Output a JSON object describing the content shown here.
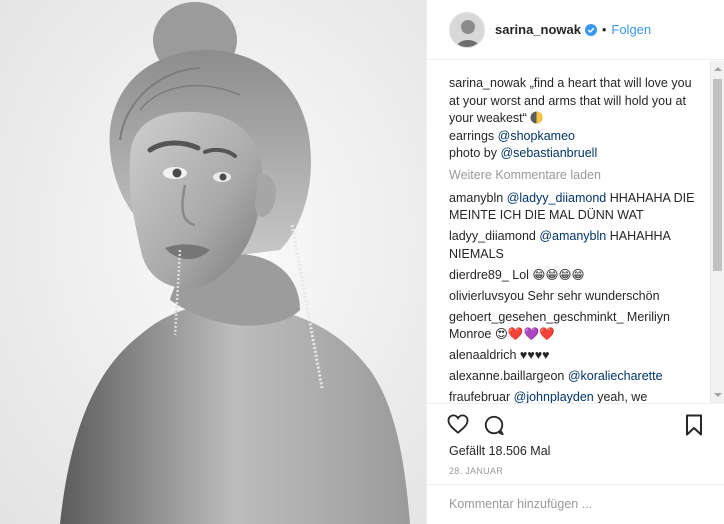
{
  "post": {
    "username": "sarina_nowak",
    "follow_label": "Folgen",
    "separator": "•",
    "photo_alt": "Black and white portrait photo",
    "caption": {
      "user": "sarina_nowak",
      "text": "„find a heart that will love you at your worst and arms that will hold you at your weakest“",
      "earrings_prefix": "earrings",
      "earrings_tag": "@shopkameo",
      "photo_prefix": "photo by",
      "photo_tag": "@sebastianbruell"
    },
    "load_more": "Weitere Kommentare laden",
    "comments": [
      {
        "user": "amanybln",
        "mention": "@ladyy_diiamond",
        "text": "HHAHAHA DIE MEINTE ICH DIE MAL DÜNN WAT"
      },
      {
        "user": "ladyy_diiamond",
        "mention": "@amanybln",
        "text": "HAHAHHA NIEMALS"
      },
      {
        "user": "dierdre89_",
        "text": "Lol",
        "emoji": "😁😁😁😁"
      },
      {
        "user": "olivierluvsyou",
        "text": "Sehr sehr wunderschön"
      },
      {
        "user": "gehoert_gesehen_geschminkt_",
        "text": "Meriliyn Monroe",
        "emoji": "😍❤️💜❤️"
      },
      {
        "user": "alenaaldrich",
        "text": "♥♥♥♥"
      },
      {
        "user": "alexanne.baillargeon",
        "mention": "@koraliecharette"
      },
      {
        "user": "fraufebruar",
        "mention": "@johnplayden",
        "text": "yeah, we"
      }
    ],
    "likes": "Gefällt 18.506 Mal",
    "date": "28. JANUAR",
    "comment_placeholder": "Kommentar hinzufügen ...",
    "icons": {
      "like": "heart-icon",
      "comment": "speech-bubble-icon",
      "save": "bookmark-icon",
      "verified": "verified-badge-icon",
      "accent": "#3897f0",
      "mention_color": "#003569"
    }
  }
}
